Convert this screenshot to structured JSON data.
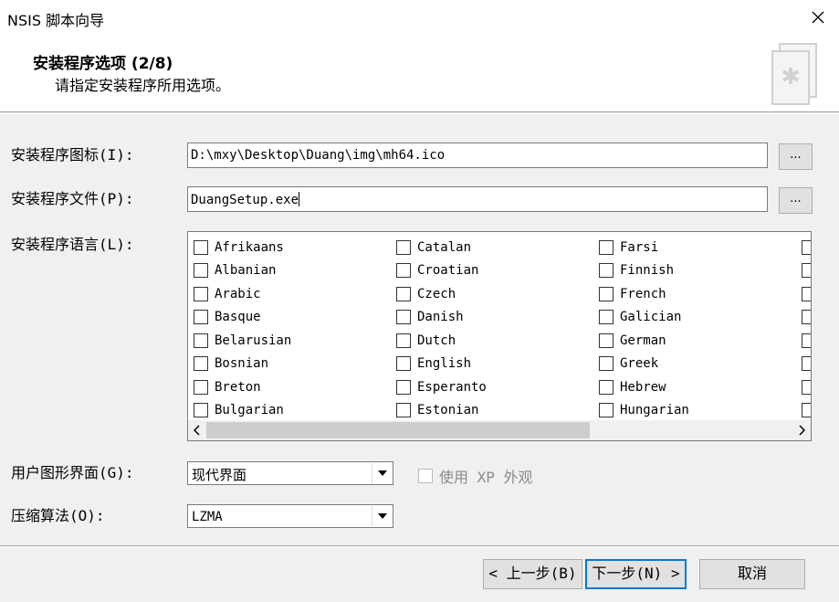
{
  "window": {
    "title": "NSIS 脚本向导",
    "close_icon": "close-icon"
  },
  "header": {
    "title": "安装程序选项 (2/8)",
    "subtitle": "请指定安装程序所用选项。",
    "icon": "wizard-document-icon"
  },
  "form": {
    "icon_label": "安装程序图标(I):",
    "icon_value": "D:\\mxy\\Desktop\\Duang\\img\\mh64.ico",
    "file_label": "安装程序文件(P):",
    "file_value": "DuangSetup.exe",
    "browse_label": "...",
    "language_label": "安装程序语言(L):",
    "ui_label": "用户图形界面(G):",
    "ui_value": "现代界面",
    "xp_label": "使用 XP 外观",
    "compression_label": "压缩算法(O):",
    "compression_value": "LZMA"
  },
  "languages": {
    "col1": [
      "Afrikaans",
      "Albanian",
      "Arabic",
      "Basque",
      "Belarusian",
      "Bosnian",
      "Breton",
      "Bulgarian"
    ],
    "col2": [
      "Catalan",
      "Croatian",
      "Czech",
      "Danish",
      "Dutch",
      "English",
      "Esperanto",
      "Estonian"
    ],
    "col3": [
      "Farsi",
      "Finnish",
      "French",
      "Galician",
      "German",
      "Greek",
      "Hebrew",
      "Hungarian"
    ]
  },
  "buttons": {
    "back": "< 上一步(B)",
    "next": "下一步(N) >",
    "cancel": "取消"
  }
}
